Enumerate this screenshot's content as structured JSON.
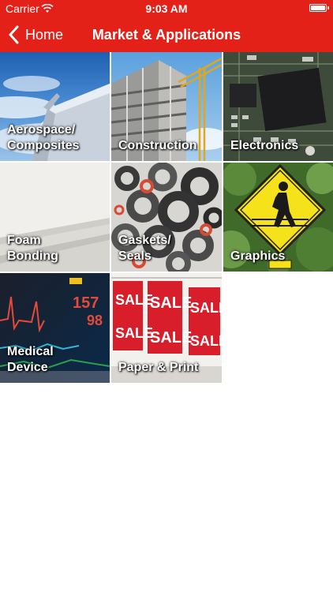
{
  "status_bar": {
    "carrier": "Carrier",
    "time": "9:03 AM"
  },
  "nav": {
    "back_label": "Home",
    "title": "Market & Applications"
  },
  "tiles": [
    {
      "line1": "Aerospace/",
      "line2": "Composites"
    },
    {
      "line1": "Construction",
      "line2": ""
    },
    {
      "line1": "Electronics",
      "line2": ""
    },
    {
      "line1": "Foam",
      "line2": "Bonding"
    },
    {
      "line1": "Gaskets/",
      "line2": "Seals"
    },
    {
      "line1": "Graphics",
      "line2": ""
    },
    {
      "line1": "Medical",
      "line2": "Device"
    },
    {
      "line1": "Paper & Print",
      "line2": ""
    }
  ],
  "image_text": {
    "medical_reading_1": "157",
    "medical_reading_2": "98",
    "sale_word": "SALE"
  },
  "colors": {
    "brand_red": "#e32119"
  }
}
